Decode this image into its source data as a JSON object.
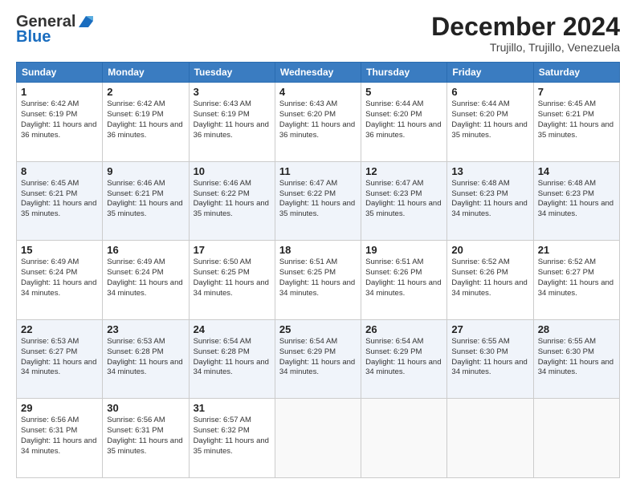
{
  "logo": {
    "line1": "General",
    "line2": "Blue"
  },
  "title": {
    "month": "December 2024",
    "location": "Trujillo, Trujillo, Venezuela"
  },
  "headers": [
    "Sunday",
    "Monday",
    "Tuesday",
    "Wednesday",
    "Thursday",
    "Friday",
    "Saturday"
  ],
  "weeks": [
    [
      {
        "day": "1",
        "sunrise": "6:42 AM",
        "sunset": "6:19 PM",
        "daylight": "11 hours and 36 minutes."
      },
      {
        "day": "2",
        "sunrise": "6:42 AM",
        "sunset": "6:19 PM",
        "daylight": "11 hours and 36 minutes."
      },
      {
        "day": "3",
        "sunrise": "6:43 AM",
        "sunset": "6:19 PM",
        "daylight": "11 hours and 36 minutes."
      },
      {
        "day": "4",
        "sunrise": "6:43 AM",
        "sunset": "6:20 PM",
        "daylight": "11 hours and 36 minutes."
      },
      {
        "day": "5",
        "sunrise": "6:44 AM",
        "sunset": "6:20 PM",
        "daylight": "11 hours and 36 minutes."
      },
      {
        "day": "6",
        "sunrise": "6:44 AM",
        "sunset": "6:20 PM",
        "daylight": "11 hours and 35 minutes."
      },
      {
        "day": "7",
        "sunrise": "6:45 AM",
        "sunset": "6:21 PM",
        "daylight": "11 hours and 35 minutes."
      }
    ],
    [
      {
        "day": "8",
        "sunrise": "6:45 AM",
        "sunset": "6:21 PM",
        "daylight": "11 hours and 35 minutes."
      },
      {
        "day": "9",
        "sunrise": "6:46 AM",
        "sunset": "6:21 PM",
        "daylight": "11 hours and 35 minutes."
      },
      {
        "day": "10",
        "sunrise": "6:46 AM",
        "sunset": "6:22 PM",
        "daylight": "11 hours and 35 minutes."
      },
      {
        "day": "11",
        "sunrise": "6:47 AM",
        "sunset": "6:22 PM",
        "daylight": "11 hours and 35 minutes."
      },
      {
        "day": "12",
        "sunrise": "6:47 AM",
        "sunset": "6:23 PM",
        "daylight": "11 hours and 35 minutes."
      },
      {
        "day": "13",
        "sunrise": "6:48 AM",
        "sunset": "6:23 PM",
        "daylight": "11 hours and 34 minutes."
      },
      {
        "day": "14",
        "sunrise": "6:48 AM",
        "sunset": "6:23 PM",
        "daylight": "11 hours and 34 minutes."
      }
    ],
    [
      {
        "day": "15",
        "sunrise": "6:49 AM",
        "sunset": "6:24 PM",
        "daylight": "11 hours and 34 minutes."
      },
      {
        "day": "16",
        "sunrise": "6:49 AM",
        "sunset": "6:24 PM",
        "daylight": "11 hours and 34 minutes."
      },
      {
        "day": "17",
        "sunrise": "6:50 AM",
        "sunset": "6:25 PM",
        "daylight": "11 hours and 34 minutes."
      },
      {
        "day": "18",
        "sunrise": "6:51 AM",
        "sunset": "6:25 PM",
        "daylight": "11 hours and 34 minutes."
      },
      {
        "day": "19",
        "sunrise": "6:51 AM",
        "sunset": "6:26 PM",
        "daylight": "11 hours and 34 minutes."
      },
      {
        "day": "20",
        "sunrise": "6:52 AM",
        "sunset": "6:26 PM",
        "daylight": "11 hours and 34 minutes."
      },
      {
        "day": "21",
        "sunrise": "6:52 AM",
        "sunset": "6:27 PM",
        "daylight": "11 hours and 34 minutes."
      }
    ],
    [
      {
        "day": "22",
        "sunrise": "6:53 AM",
        "sunset": "6:27 PM",
        "daylight": "11 hours and 34 minutes."
      },
      {
        "day": "23",
        "sunrise": "6:53 AM",
        "sunset": "6:28 PM",
        "daylight": "11 hours and 34 minutes."
      },
      {
        "day": "24",
        "sunrise": "6:54 AM",
        "sunset": "6:28 PM",
        "daylight": "11 hours and 34 minutes."
      },
      {
        "day": "25",
        "sunrise": "6:54 AM",
        "sunset": "6:29 PM",
        "daylight": "11 hours and 34 minutes."
      },
      {
        "day": "26",
        "sunrise": "6:54 AM",
        "sunset": "6:29 PM",
        "daylight": "11 hours and 34 minutes."
      },
      {
        "day": "27",
        "sunrise": "6:55 AM",
        "sunset": "6:30 PM",
        "daylight": "11 hours and 34 minutes."
      },
      {
        "day": "28",
        "sunrise": "6:55 AM",
        "sunset": "6:30 PM",
        "daylight": "11 hours and 34 minutes."
      }
    ],
    [
      {
        "day": "29",
        "sunrise": "6:56 AM",
        "sunset": "6:31 PM",
        "daylight": "11 hours and 34 minutes."
      },
      {
        "day": "30",
        "sunrise": "6:56 AM",
        "sunset": "6:31 PM",
        "daylight": "11 hours and 35 minutes."
      },
      {
        "day": "31",
        "sunrise": "6:57 AM",
        "sunset": "6:32 PM",
        "daylight": "11 hours and 35 minutes."
      },
      null,
      null,
      null,
      null
    ]
  ],
  "labels": {
    "sunrise": "Sunrise:",
    "sunset": "Sunset:",
    "daylight": "Daylight:"
  }
}
